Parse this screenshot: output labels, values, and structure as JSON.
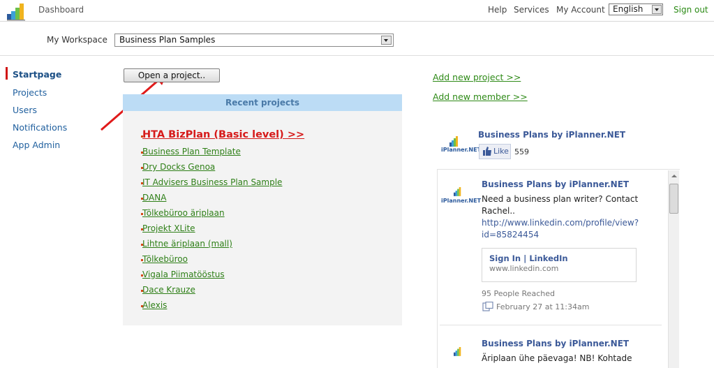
{
  "header": {
    "dashboard_label": "Dashboard",
    "nav": {
      "help": "Help",
      "services": "Services",
      "my_account": "My Account"
    },
    "language": {
      "selected": "English"
    },
    "signout_label": "Sign out"
  },
  "workspace": {
    "label": "My Workspace",
    "selected": "Business Plan Samples"
  },
  "sidebar": {
    "items": [
      {
        "label": "Startpage",
        "active": true
      },
      {
        "label": "Projects",
        "active": false
      },
      {
        "label": "Users",
        "active": false
      },
      {
        "label": "Notifications",
        "active": false
      },
      {
        "label": "App Admin",
        "active": false
      }
    ]
  },
  "main": {
    "open_project_label": "Open a project..",
    "recent": {
      "title": "Recent projects",
      "items": [
        "HTA BizPlan (Basic level) >>",
        "Business Plan Template",
        "Dry Docks Genoa",
        "IT Advisers Business Plan Sample",
        "DANA",
        "Tõlkebüroo äriplaan",
        "Projekt XLite",
        "Lihtne äriplaan (mall)",
        "Tõlkebüroo",
        "Vigala Piimatööstus",
        "Dace Krauze",
        "Alexis"
      ]
    }
  },
  "right": {
    "add_project_label": "Add new project >>",
    "add_member_label": "Add new member >>",
    "fb": {
      "page_name": "Business Plans by iPlanner.NET",
      "logo_text": "iPlanner.NET",
      "like_label": "Like",
      "like_count": "559",
      "posts": [
        {
          "author": "Business Plans by iPlanner.NET",
          "text_line1": "Need a business plan writer? Contact",
          "text_line2": "Rachel..",
          "link_line1": "http://www.linkedin.com/profile/view?",
          "link_line2": "id=85824454",
          "share_title": "Sign In | LinkedIn",
          "share_domain": "www.linkedin.com",
          "reach": "95 People Reached",
          "date": "February 27 at 11:34am"
        },
        {
          "author": "Business Plans by iPlanner.NET",
          "text_line1": "Äriplaan ühe päevaga! NB! Kohtade"
        }
      ]
    }
  },
  "colors": {
    "accent_green": "#2e8a17",
    "link_blue": "#1f5f9e",
    "highlight_red": "#d61a1a",
    "recent_header_bg": "#bcdcf5",
    "fb_blue": "#3b5998"
  }
}
